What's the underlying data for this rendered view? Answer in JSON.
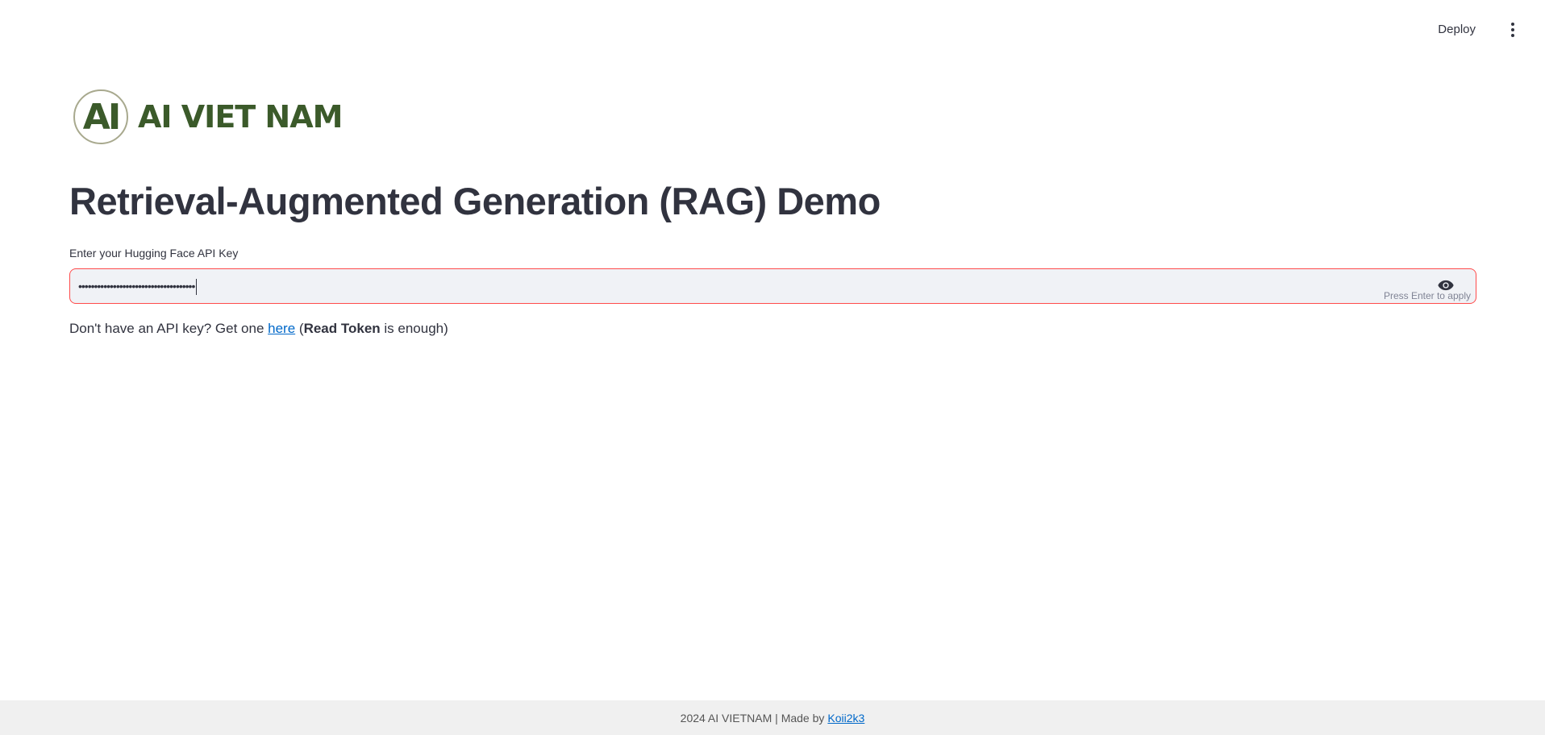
{
  "header": {
    "deploy_label": "Deploy",
    "menu_icon": "vertical-dots-icon"
  },
  "logo": {
    "circle_text": "AI",
    "wordmark": "AI VIET NAM",
    "brand_color": "#3b5a2a"
  },
  "main": {
    "title": "Retrieval-Augmented Generation (RAG) Demo",
    "api_key_field": {
      "label": "Enter your Hugging Face API Key",
      "masked_value": "•••••••••••••••••••••••••••••••••••••",
      "hint": "Press Enter to apply",
      "toggle_icon": "eye-icon"
    },
    "helper": {
      "prefix": "Don't have an API key? Get one ",
      "link_text": "here",
      "paren_open": " (",
      "bold_text": "Read Token",
      "suffix": " is enough)"
    }
  },
  "footer": {
    "text": "2024 AI VIETNAM | Made by",
    "link_text": "Koii2k3"
  },
  "colors": {
    "accent_border": "#ff4b4b",
    "link": "#0068c9",
    "input_bg": "#f0f2f6",
    "footer_bg": "#f0f0f0"
  }
}
